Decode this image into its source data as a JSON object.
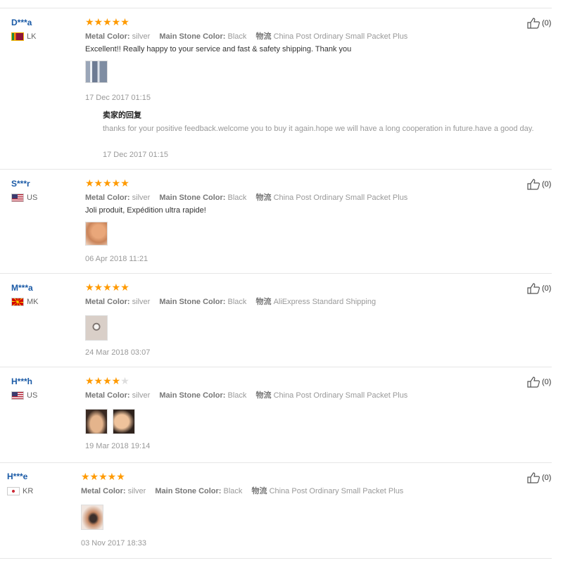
{
  "labels": {
    "metal_color": "Metal Color:",
    "main_stone_color": "Main Stone Color:",
    "shipping": "物流"
  },
  "reviews": [
    {
      "user": "D***a",
      "country": "LK",
      "stars": 5,
      "metal_color": "silver",
      "main_stone_color": "Black",
      "shipping": "China Post Ordinary Small Packet Plus",
      "text": "Excellent!! Really happy to your service and fast & safety shipping. Thank you",
      "date": "17 Dec 2017 01:15",
      "likes": "(0)",
      "reply": {
        "title": "卖家的回复",
        "text": "thanks for your positive feedback.welcome you to buy it again.hope we will have a long cooperation in future.have a good day.",
        "date": "17 Dec 2017 01:15"
      }
    },
    {
      "user": "S***r",
      "country": "US",
      "stars": 5,
      "metal_color": "silver",
      "main_stone_color": "Black",
      "shipping": "China Post Ordinary Small Packet Plus",
      "text": "Joli produit, Expédition ultra rapide!",
      "date": "06 Apr 2018 11:21",
      "likes": "(0)"
    },
    {
      "user": "M***a",
      "country": "MK",
      "stars": 5,
      "metal_color": "silver",
      "main_stone_color": "Black",
      "shipping": "AliExpress Standard Shipping",
      "date": "24 Mar 2018 03:07",
      "likes": "(0)"
    },
    {
      "user": "H***h",
      "country": "US",
      "stars": 4,
      "metal_color": "silver",
      "main_stone_color": "Black",
      "shipping": "China Post Ordinary Small Packet Plus",
      "date": "19 Mar 2018 19:14",
      "likes": "(0)"
    },
    {
      "user": "H***e",
      "country": "KR",
      "stars": 5,
      "metal_color": "silver",
      "main_stone_color": "Black",
      "shipping": "China Post Ordinary Small Packet Plus",
      "date": "03 Nov 2017 18:33",
      "likes": "(0)"
    }
  ],
  "colors": {
    "star": "#ff9a00",
    "star_empty": "#dddddd",
    "username": "#1a5aa6"
  }
}
